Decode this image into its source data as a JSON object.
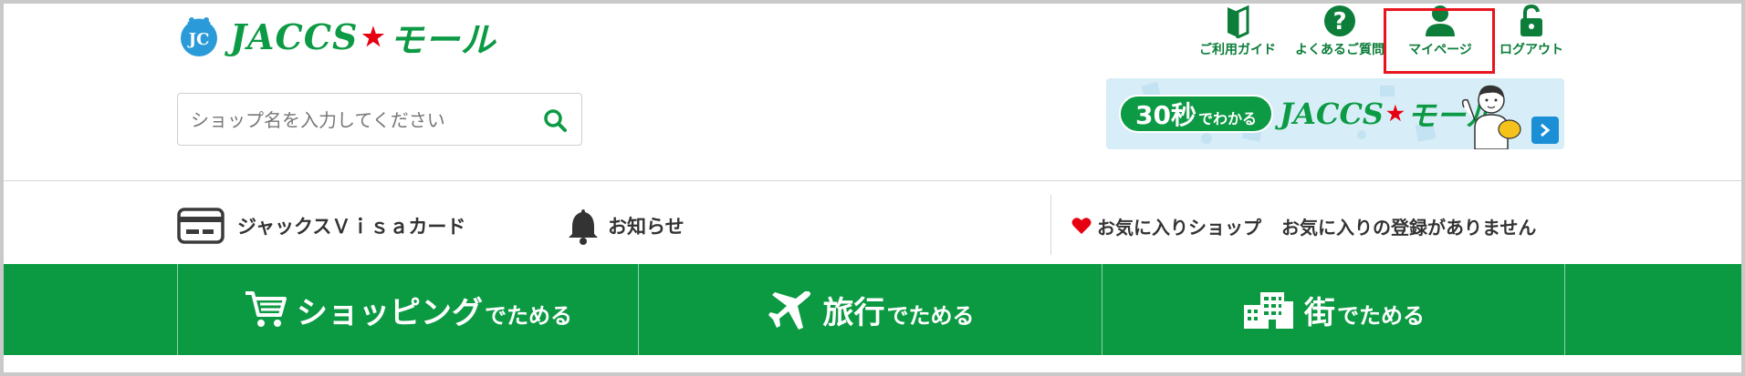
{
  "header": {
    "logo_text": "JACCS",
    "logo_star": "★",
    "logo_suffix": "モール",
    "logo_mark": "JC"
  },
  "search": {
    "placeholder": "ショップ名を入力してください",
    "value": ""
  },
  "header_nav": [
    {
      "label": "ご利用ガイド",
      "icon": "guide-book-icon"
    },
    {
      "label": "よくあるご質問",
      "icon": "question-icon"
    },
    {
      "label": "マイページ",
      "icon": "user-icon",
      "highlighted": true
    },
    {
      "label": "ログアウト",
      "icon": "unlock-icon"
    }
  ],
  "banner": {
    "big": "30秒",
    "small": "でわかる",
    "logo_text": "JACCS",
    "logo_star": "★",
    "logo_suffix": "モール"
  },
  "subnav": {
    "card_label": "ジャックスＶｉｓａカード",
    "news_label": "お知らせ",
    "favorites_label": "お気に入りショップ",
    "favorites_empty": "お気に入りの登録がありません"
  },
  "tabs": [
    {
      "main": "ショッピング",
      "sub": "でためる",
      "icon": "cart-icon"
    },
    {
      "main": "旅行",
      "sub": "でためる",
      "icon": "airplane-icon"
    },
    {
      "main": "街",
      "sub": "でためる",
      "icon": "building-icon"
    }
  ],
  "colors": {
    "brand_green": "#0b9a42",
    "highlight_red": "#e8141e",
    "star_red": "#e60012",
    "banner_bg": "#d7eef8"
  }
}
